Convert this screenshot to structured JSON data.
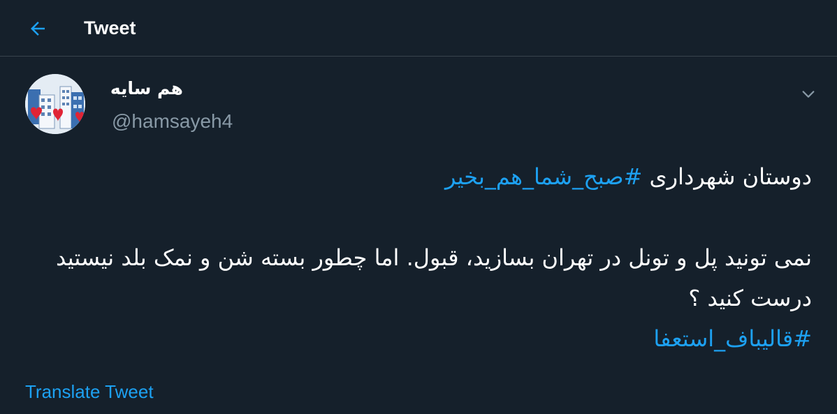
{
  "header": {
    "back_icon": "arrow-left-icon",
    "title": "Tweet"
  },
  "tweet": {
    "author": {
      "display_name": "هم سایه",
      "handle": "@hamsayeh4",
      "avatar_icon": "buildings-with-hearts-avatar"
    },
    "menu_icon": "chevron-down-icon",
    "body": {
      "line1_text": "دوستان شهرداری ",
      "line1_hashtag": "#صبح_شما_هم_بخیر",
      "paragraph2": "نمی تونید پل و تونل در تهران بسازید، قبول. اما چطور بسته شن و نمک بلد نیستید درست کنید ؟",
      "hashtag2": "#قالیباف_استعفا"
    },
    "translate_label": "Translate Tweet"
  },
  "colors": {
    "background": "#15202b",
    "accent": "#1da1f2",
    "secondary_text": "#8899a6",
    "divider": "#38444d"
  }
}
